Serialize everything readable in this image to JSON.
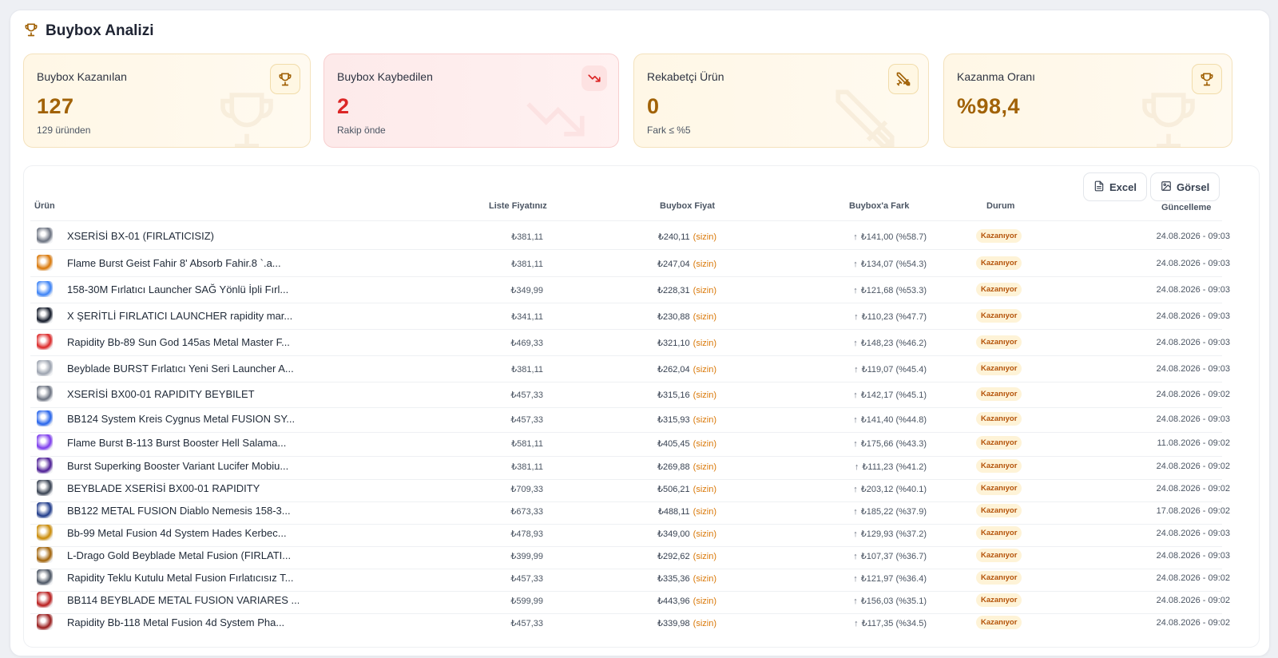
{
  "header": {
    "title": "Buybox Analizi",
    "icon": "trophy-icon"
  },
  "cards": [
    {
      "title": "Buybox Kazanılan",
      "value": "127",
      "sub": "129 üründen",
      "icon": "trophy-icon"
    },
    {
      "title": "Buybox Kaybedilen",
      "value": "2",
      "sub": "Rakip önde",
      "icon": "trend-down-icon"
    },
    {
      "title": "Rekabetçi Ürün",
      "value": "0",
      "sub": "Fark ≤ %5",
      "icon": "crossed-swords-icon"
    },
    {
      "title": "Kazanma Oranı",
      "value": "%98,4",
      "sub": "",
      "icon": "trophy-icon"
    }
  ],
  "actions": {
    "excel": "Excel",
    "image": "Görsel"
  },
  "table": {
    "columns": {
      "product": "Ürün",
      "list_price": "Liste Fiyatınız",
      "buybox_price": "Buybox Fiyat",
      "diff": "Buybox'a Fark",
      "status": "Durum",
      "updated": "Güncelleme"
    },
    "you_label": "(sizin)",
    "rows": [
      {
        "name": "XSERİSİ BX-01 (FIRLATICISIZ)",
        "list": "₺381,11",
        "buybox": "₺240,11",
        "diff": "₺141,00 (%58.7)",
        "status": "Kazanıyor",
        "updated": "24.08.2026 - 09:03",
        "thumb": "#6b7280"
      },
      {
        "name": "Flame Burst Geist Fahir 8' Absorb Fahir.8 `.a...",
        "list": "₺381,11",
        "buybox": "₺247,04",
        "diff": "₺134,07 (%54.3)",
        "status": "Kazanıyor",
        "updated": "24.08.2026 - 09:03",
        "thumb": "#d97706"
      },
      {
        "name": "158-30M Fırlatıcı Launcher SAĞ Yönlü İpli Fırl...",
        "list": "₺349,99",
        "buybox": "₺228,31",
        "diff": "₺121,68 (%53.3)",
        "status": "Kazanıyor",
        "updated": "24.08.2026 - 09:03",
        "thumb": "#3b82f6"
      },
      {
        "name": "X ŞERİTLİ FIRLATICI LAUNCHER rapidity mar...",
        "list": "₺341,11",
        "buybox": "₺230,88",
        "diff": "₺110,23 (%47.7)",
        "status": "Kazanıyor",
        "updated": "24.08.2026 - 09:03",
        "thumb": "#111827"
      },
      {
        "name": "Rapidity Bb-89 Sun God 145as Metal Master F...",
        "list": "₺469,33",
        "buybox": "₺321,10",
        "diff": "₺148,23 (%46.2)",
        "status": "Kazanıyor",
        "updated": "24.08.2026 - 09:03",
        "thumb": "#dc2626"
      },
      {
        "name": "Beyblade BURST Fırlatıcı Yeni Seri Launcher A...",
        "list": "₺381,11",
        "buybox": "₺262,04",
        "diff": "₺119,07 (%45.4)",
        "status": "Kazanıyor",
        "updated": "24.08.2026 - 09:03",
        "thumb": "#9ca3af"
      },
      {
        "name": "XSERİSİ BX00-01 RAPIDITY BEYBILET",
        "list": "₺457,33",
        "buybox": "₺315,16",
        "diff": "₺142,17 (%45.1)",
        "status": "Kazanıyor",
        "updated": "24.08.2026 - 09:02",
        "thumb": "#6b7280"
      },
      {
        "name": "BB124 System Kreis Cygnus Metal FUSION SY...",
        "list": "₺457,33",
        "buybox": "₺315,93",
        "diff": "₺141,40 (%44.8)",
        "status": "Kazanıyor",
        "updated": "24.08.2026 - 09:03",
        "thumb": "#2563eb"
      },
      {
        "name": "Flame Burst B-113 Burst Booster Hell Salama...",
        "list": "₺581,11",
        "buybox": "₺405,45",
        "diff": "₺175,66 (%43.3)",
        "status": "Kazanıyor",
        "updated": "11.08.2026 - 09:02",
        "thumb": "#7c3aed"
      },
      {
        "name": "Burst Superking Booster Variant Lucifer Mobiu...",
        "list": "₺381,11",
        "buybox": "₺269,88",
        "diff": "₺111,23 (%41.2)",
        "status": "Kazanıyor",
        "updated": "24.08.2026 - 09:02",
        "thumb": "#4c1d95"
      },
      {
        "name": "BEYBLADE XSERİSİ BX00-01 RAPIDITY",
        "list": "₺709,33",
        "buybox": "₺506,21",
        "diff": "₺203,12 (%40.1)",
        "status": "Kazanıyor",
        "updated": "24.08.2026 - 09:02",
        "thumb": "#374151"
      },
      {
        "name": "BB122 METAL FUSION Diablo Nemesis 158-3...",
        "list": "₺673,33",
        "buybox": "₺488,11",
        "diff": "₺185,22 (%37.9)",
        "status": "Kazanıyor",
        "updated": "17.08.2026 - 09:02",
        "thumb": "#1e3a8a"
      },
      {
        "name": "Bb-99 Metal Fusion 4d System Hades Kerbec...",
        "list": "₺478,93",
        "buybox": "₺349,00",
        "diff": "₺129,93 (%37.2)",
        "status": "Kazanıyor",
        "updated": "24.08.2026 - 09:03",
        "thumb": "#ca8a04"
      },
      {
        "name": "L-Drago Gold Beyblade Metal Fusion (FIRLATI...",
        "list": "₺399,99",
        "buybox": "₺292,62",
        "diff": "₺107,37 (%36.7)",
        "status": "Kazanıyor",
        "updated": "24.08.2026 - 09:03",
        "thumb": "#a16207"
      },
      {
        "name": "Rapidity Teklu Kutulu Metal Fusion Fırlatıcısız T...",
        "list": "₺457,33",
        "buybox": "₺335,36",
        "diff": "₺121,97 (%36.4)",
        "status": "Kazanıyor",
        "updated": "24.08.2026 - 09:02",
        "thumb": "#4b5563"
      },
      {
        "name": "BB114 BEYBLADE METAL FUSION VARIARES ...",
        "list": "₺599,99",
        "buybox": "₺443,96",
        "diff": "₺156,03 (%35.1)",
        "status": "Kazanıyor",
        "updated": "24.08.2026 - 09:02",
        "thumb": "#b91c1c"
      },
      {
        "name": "Rapidity Bb-118 Metal Fusion 4d System Pha...",
        "list": "₺457,33",
        "buybox": "₺339,98",
        "diff": "₺117,35 (%34.5)",
        "status": "Kazanıyor",
        "updated": "24.08.2026 - 09:02",
        "thumb": "#991b1b"
      }
    ]
  }
}
